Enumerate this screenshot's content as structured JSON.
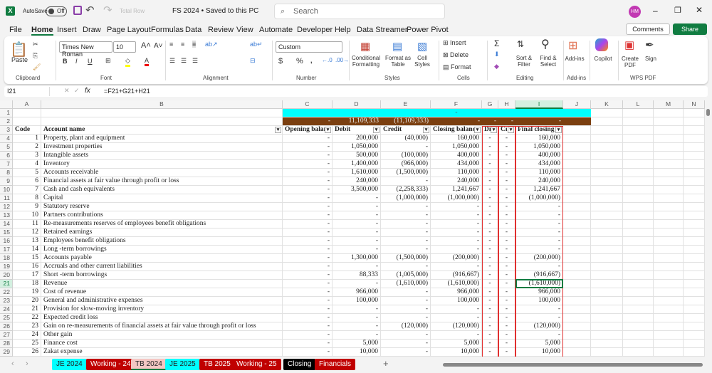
{
  "title": {
    "autosave": "AutoSave",
    "toggle": "Off",
    "total_row": "Total Row",
    "doc": "FS 2024 • Saved to this PC",
    "search": "Search",
    "avatar": "HM",
    "logo": "X"
  },
  "menu": [
    "File",
    "Home",
    "Insert",
    "Draw",
    "Page Layout",
    "Formulas",
    "Data",
    "Review",
    "View",
    "Automate",
    "Developer",
    "Help",
    "Data Streamer",
    "Power Pivot"
  ],
  "menu_right": {
    "comments": "Comments",
    "share": "Share"
  },
  "ribbon": {
    "paste": "Paste",
    "font": "Times New Roman",
    "size": "10",
    "number_format": "Custom",
    "cond": "Conditional Formatting",
    "fmt_table": "Format as Table",
    "cell_styles": "Cell Styles",
    "insert": "Insert",
    "delete": "Delete",
    "format": "Format",
    "sort": "Sort & Filter",
    "find": "Find & Select",
    "addins": "Add-ins",
    "copilot": "Copilot",
    "create_pdf": "Create PDF",
    "sign": "Sign",
    "groups": [
      "Clipboard",
      "Font",
      "Alignment",
      "Number",
      "Styles",
      "Cells",
      "Editing",
      "Add-ins",
      "WPS PDF"
    ]
  },
  "formula": {
    "namebox": "I21",
    "fx": "fx",
    "formula": "=F21+G21+H21"
  },
  "columns": [
    "A",
    "B",
    "C",
    "D",
    "E",
    "F",
    "G",
    "H",
    "I",
    "J",
    "K",
    "L",
    "M",
    "N"
  ],
  "row1": "-",
  "row2": [
    "-",
    "11,109,333",
    "(11,109,333)",
    "-",
    "-",
    "-",
    "-"
  ],
  "headers": [
    "Code",
    "Account name",
    "Opening balanc",
    "Debit",
    "Credit",
    "Closing balanc",
    "Dı",
    "Cı",
    "Final closing"
  ],
  "rows": [
    [
      "1",
      "Property, plant and equipment",
      "-",
      "200,000",
      "(40,000)",
      "160,000",
      "-",
      "-",
      "160,000"
    ],
    [
      "2",
      "Investment properties",
      "-",
      "1,050,000",
      "-",
      "1,050,000",
      "-",
      "-",
      "1,050,000"
    ],
    [
      "3",
      "Intangible assets",
      "-",
      "500,000",
      "(100,000)",
      "400,000",
      "-",
      "-",
      "400,000"
    ],
    [
      "4",
      "Inventory",
      "-",
      "1,400,000",
      "(966,000)",
      "434,000",
      "-",
      "-",
      "434,000"
    ],
    [
      "5",
      "Accounts receivable",
      "-",
      "1,610,000",
      "(1,500,000)",
      "110,000",
      "-",
      "-",
      "110,000"
    ],
    [
      "6",
      "Financial assets at fair value through profit or loss",
      "-",
      "240,000",
      "-",
      "240,000",
      "-",
      "-",
      "240,000"
    ],
    [
      "7",
      "Cash and cash equivalents",
      "-",
      "3,500,000",
      "(2,258,333)",
      "1,241,667",
      "-",
      "-",
      "1,241,667"
    ],
    [
      "8",
      "Capital",
      "-",
      "-",
      "(1,000,000)",
      "(1,000,000)",
      "-",
      "-",
      "(1,000,000)"
    ],
    [
      "9",
      "Statutory reserve",
      "-",
      "-",
      "-",
      "-",
      "-",
      "-",
      "-"
    ],
    [
      "10",
      "Partners contributions",
      "-",
      "-",
      "-",
      "-",
      "-",
      "-",
      "-"
    ],
    [
      "11",
      "Re-measurements reserves of employees benefit obligations",
      "-",
      "-",
      "-",
      "-",
      "-",
      "-",
      "-"
    ],
    [
      "12",
      "Retained earnings",
      "-",
      "-",
      "-",
      "-",
      "-",
      "-",
      "-"
    ],
    [
      "13",
      "Employees benefit obligations",
      "-",
      "-",
      "-",
      "-",
      "-",
      "-",
      "-"
    ],
    [
      "14",
      "Long -term borrowings",
      "-",
      "-",
      "-",
      "-",
      "-",
      "-",
      "-"
    ],
    [
      "15",
      "Accounts payable",
      "-",
      "1,300,000",
      "(1,500,000)",
      "(200,000)",
      "-",
      "-",
      "(200,000)"
    ],
    [
      "16",
      "Accruals and other current liabilities",
      "-",
      "-",
      "-",
      "-",
      "-",
      "-",
      "-"
    ],
    [
      "17",
      "Short -term borrowings",
      "-",
      "88,333",
      "(1,005,000)",
      "(916,667)",
      "-",
      "-",
      "(916,667)"
    ],
    [
      "18",
      "Revenue",
      "-",
      "-",
      "(1,610,000)",
      "(1,610,000)",
      "-",
      "-",
      "(1,610,000)"
    ],
    [
      "19",
      "Cost of revenue",
      "-",
      "966,000",
      "-",
      "966,000",
      "-",
      "-",
      "966,000"
    ],
    [
      "20",
      "General and administrative expenses",
      "-",
      "100,000",
      "-",
      "100,000",
      "-",
      "-",
      "100,000"
    ],
    [
      "21",
      "Provision for slow-moving inventory",
      "-",
      "-",
      "-",
      "-",
      "-",
      "-",
      "-"
    ],
    [
      "22",
      "Expected credit loss",
      "-",
      "-",
      "-",
      "-",
      "-",
      "-",
      "-"
    ],
    [
      "23",
      "Gain on re-measurements of financial assets at fair value through profit or loss",
      "-",
      "-",
      "(120,000)",
      "(120,000)",
      "-",
      "-",
      "(120,000)"
    ],
    [
      "24",
      "Other gain",
      "-",
      "-",
      "-",
      "-",
      "-",
      "-",
      "-"
    ],
    [
      "25",
      "Finance cost",
      "-",
      "5,000",
      "-",
      "5,000",
      "-",
      "-",
      "5,000"
    ],
    [
      "26",
      "Zakat expense",
      "-",
      "10,000",
      "-",
      "10,000",
      "-",
      "-",
      "10,000"
    ]
  ],
  "sheets": [
    {
      "name": "JE 2024",
      "bg": "#00ffff",
      "fg": "#222"
    },
    {
      "name": "Working - 24",
      "bg": "#c00000",
      "fg": "#fff"
    },
    {
      "name": "TB 2024",
      "bg": "#f4c7c3",
      "fg": "#222",
      "active": true
    },
    {
      "name": "JE 2025",
      "bg": "#00ffff",
      "fg": "#222"
    },
    {
      "name": "TB 2025",
      "bg": "#c00000",
      "fg": "#fff"
    },
    {
      "name": "Working - 25",
      "bg": "#c00000",
      "fg": "#fff"
    },
    {
      "name": "Closing",
      "bg": "#000000",
      "fg": "#fff"
    },
    {
      "name": "Financials",
      "bg": "#c00000",
      "fg": "#fff"
    }
  ],
  "add_sheet": "+"
}
